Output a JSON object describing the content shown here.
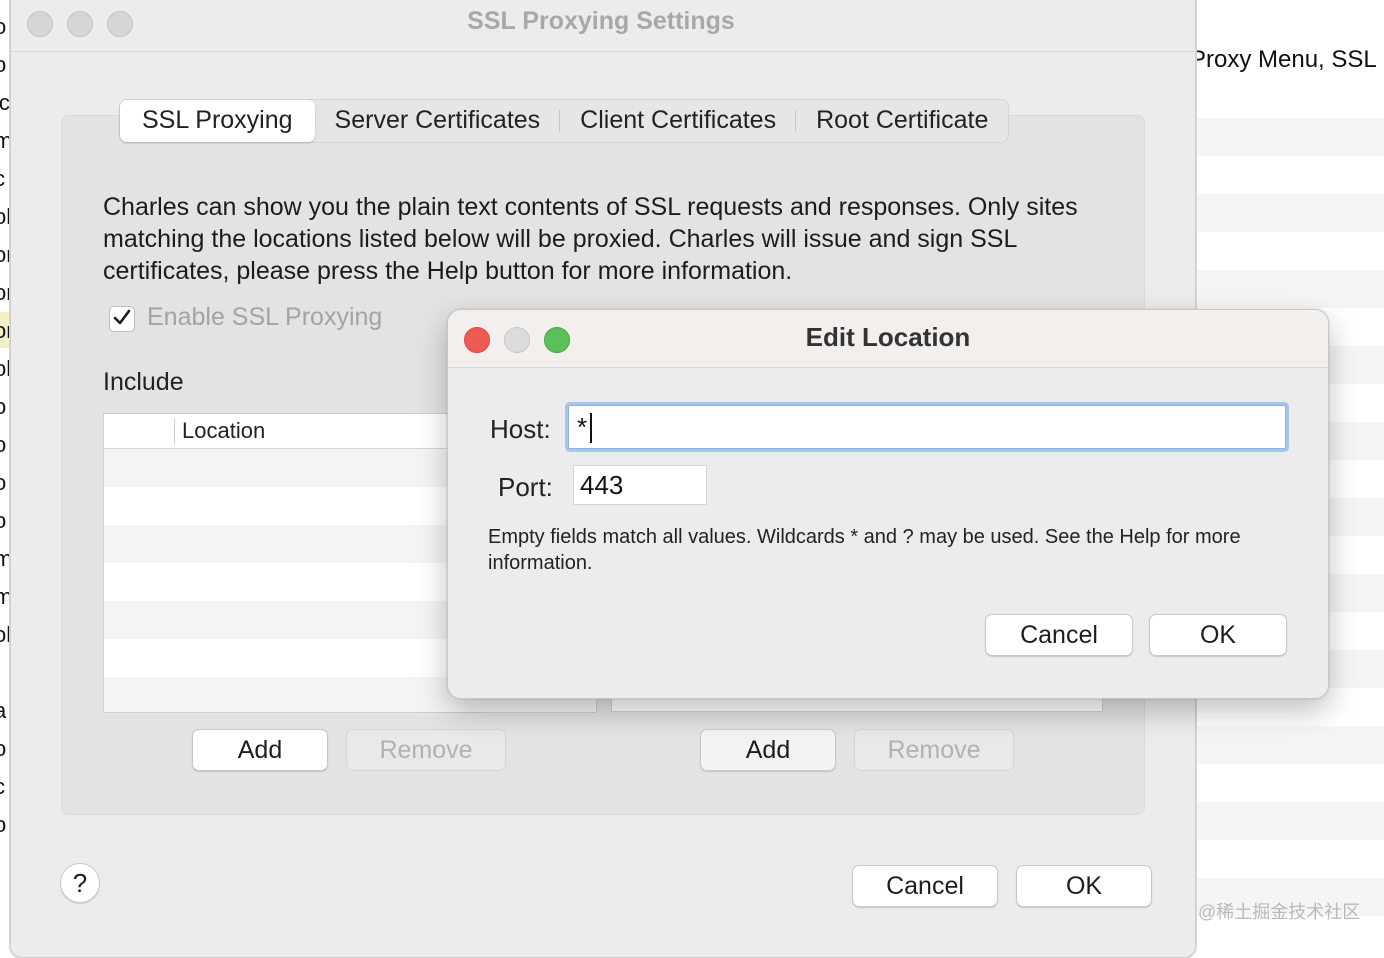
{
  "background": {
    "left_edge_glyphs": [
      "o",
      "o",
      "ic",
      "m",
      "c",
      "ol",
      "or",
      "or",
      "or",
      "ol",
      "o",
      "o",
      "o",
      "o",
      "m",
      "m",
      "ol",
      ".",
      "a",
      "o",
      "c",
      "o"
    ],
    "right_doc_text": "Proxy Menu, SSL",
    "watermark": "@稀土掘金技术社区"
  },
  "window": {
    "title": "SSL Proxying Settings",
    "tabs": [
      {
        "label": "SSL Proxying",
        "active": true
      },
      {
        "label": "Server Certificates",
        "active": false
      },
      {
        "label": "Client Certificates",
        "active": false
      },
      {
        "label": "Root Certificate",
        "active": false
      }
    ],
    "description": "Charles can show you the plain text contents of SSL requests and responses. Only sites matching the locations listed below will be proxied. Charles will issue and sign SSL certificates, please press the Help button for more information.",
    "enable_ssl_proxying": {
      "label": "Enable SSL Proxying",
      "checked": true
    },
    "include_label": "Include",
    "include_table": {
      "column": "Location",
      "rows": []
    },
    "include_buttons": {
      "add": "Add",
      "remove": "Remove"
    },
    "exclude_buttons": {
      "add": "Add",
      "remove": "Remove"
    },
    "help_label": "?",
    "cancel_label": "Cancel",
    "ok_label": "OK"
  },
  "dialog": {
    "title": "Edit Location",
    "host_label": "Host:",
    "host_value": "*",
    "port_label": "Port:",
    "port_value": "443",
    "hint": "Empty fields match all values. Wildcards * and ? may be used. See the Help for more information.",
    "cancel_label": "Cancel",
    "ok_label": "OK"
  },
  "colors": {
    "close": "#ee5a52",
    "minimize": "#dcdcdc",
    "zoom": "#5ac05a",
    "focus_ring": "#a7c4ef"
  }
}
